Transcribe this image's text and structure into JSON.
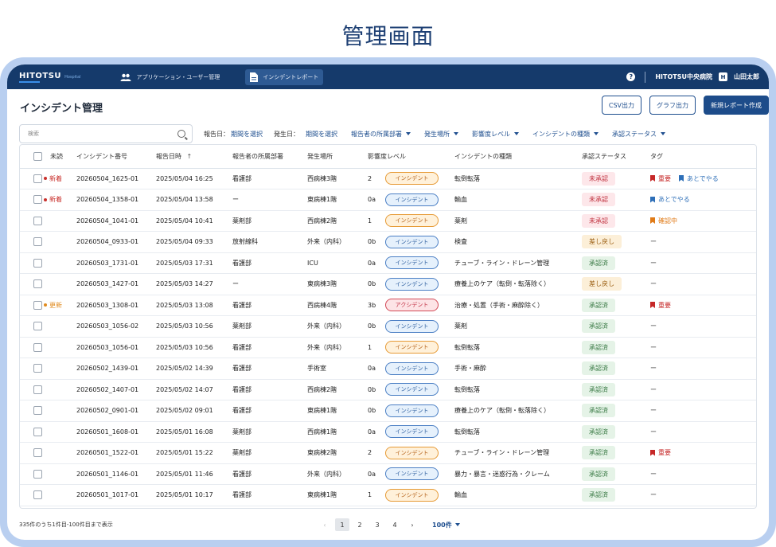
{
  "page_title": "管理画面",
  "header": {
    "logo": "HITOTSU",
    "logo_sub": "Hospital",
    "nav": [
      {
        "label": "アプリケーション・ユーザー管理",
        "icon": "users-icon"
      },
      {
        "label": "インシデントレポート",
        "icon": "document-icon"
      }
    ],
    "help_icon": "?",
    "hospital": "HITOTSU中央病院",
    "user_initial": "H",
    "user_name": "山田太郎"
  },
  "main": {
    "title": "インシデント管理",
    "buttons": {
      "csv": "CSV出力",
      "graph": "グラフ出力",
      "new": "新規レポート作成"
    },
    "search_placeholder": "検索",
    "filters": {
      "report_date_label": "報告日：",
      "report_date_value": "期間を選択",
      "occur_date_label": "発生日：",
      "occur_date_value": "期間を選択",
      "dept": "報告者の所属部署",
      "place": "発生場所",
      "impact": "影響度レベル",
      "type": "インシデントの種類",
      "approval": "承認ステータス"
    },
    "columns": {
      "unread": "未読",
      "number": "インシデント番号",
      "datetime": "報告日時",
      "dept": "報告者の所属部署",
      "place": "発生場所",
      "impact": "影響度レベル",
      "type": "インシデントの種類",
      "approval": "承認ステータス",
      "tag": "タグ"
    },
    "sort_icon": "↑",
    "rows": [
      {
        "unread": "新着",
        "unread_kind": "new",
        "number": "20260504_1625-01",
        "datetime": "2025/05/04 16:25",
        "dept": "看護部",
        "place": "西病棟3階",
        "level": "2",
        "pill": "インシデント",
        "pill_kind": "warn",
        "type": "転倒転落",
        "approval": "未承認",
        "approval_kind": "un",
        "tags": [
          {
            "label": "重要",
            "color": "red"
          },
          {
            "label": "あとでやる",
            "color": "blue"
          }
        ]
      },
      {
        "unread": "新着",
        "unread_kind": "new",
        "number": "20260504_1358-01",
        "datetime": "2025/05/04 13:58",
        "dept": "ー",
        "place": "東病棟1階",
        "level": "0a",
        "pill": "インシデント",
        "pill_kind": "info",
        "type": "輸血",
        "approval": "未承認",
        "approval_kind": "un",
        "tags": [
          {
            "label": "あとでやる",
            "color": "blue"
          }
        ]
      },
      {
        "unread": "",
        "unread_kind": "",
        "number": "20260504_1041-01",
        "datetime": "2025/05/04 10:41",
        "dept": "薬剤部",
        "place": "西病棟2階",
        "level": "1",
        "pill": "インシデント",
        "pill_kind": "warn",
        "type": "薬剤",
        "approval": "未承認",
        "approval_kind": "un",
        "tags": [
          {
            "label": "確認中",
            "color": "orange"
          }
        ]
      },
      {
        "unread": "",
        "unread_kind": "",
        "number": "20260504_0933-01",
        "datetime": "2025/05/04 09:33",
        "dept": "放射線科",
        "place": "外来（内科）",
        "level": "0b",
        "pill": "インシデント",
        "pill_kind": "info",
        "type": "検査",
        "approval": "差し戻し",
        "approval_kind": "back",
        "tags": [],
        "dash": "ー"
      },
      {
        "unread": "",
        "unread_kind": "",
        "number": "20260503_1731-01",
        "datetime": "2025/05/03 17:31",
        "dept": "看護部",
        "place": "ICU",
        "level": "0a",
        "pill": "インシデント",
        "pill_kind": "info",
        "type": "チューブ・ライン・ドレーン管理",
        "approval": "承認済",
        "approval_kind": "ok",
        "tags": [],
        "dash": "ー"
      },
      {
        "unread": "",
        "unread_kind": "",
        "number": "20260503_1427-01",
        "datetime": "2025/05/03 14:27",
        "dept": "ー",
        "place": "東病棟3階",
        "level": "0b",
        "pill": "インシデント",
        "pill_kind": "info",
        "type": "療養上のケア（転倒・転落除く）",
        "approval": "差し戻し",
        "approval_kind": "back",
        "tags": [],
        "dash": "ー"
      },
      {
        "unread": "更新",
        "unread_kind": "upd",
        "number": "20260503_1308-01",
        "datetime": "2025/05/03 13:08",
        "dept": "看護部",
        "place": "西病棟4階",
        "level": "3b",
        "pill": "アクシデント",
        "pill_kind": "acc",
        "type": "治療・処置（手術・麻酔除く）",
        "approval": "承認済",
        "approval_kind": "ok",
        "tags": [
          {
            "label": "重要",
            "color": "red"
          }
        ]
      },
      {
        "unread": "",
        "unread_kind": "",
        "number": "20260503_1056-02",
        "datetime": "2025/05/03 10:56",
        "dept": "薬剤部",
        "place": "外来（内科）",
        "level": "0b",
        "pill": "インシデント",
        "pill_kind": "info",
        "type": "薬剤",
        "approval": "承認済",
        "approval_kind": "ok",
        "tags": [],
        "dash": "ー"
      },
      {
        "unread": "",
        "unread_kind": "",
        "number": "20260503_1056-01",
        "datetime": "2025/05/03 10:56",
        "dept": "看護部",
        "place": "外来（内科）",
        "level": "1",
        "pill": "インシデント",
        "pill_kind": "warn",
        "type": "転倒転落",
        "approval": "承認済",
        "approval_kind": "ok",
        "tags": [],
        "dash": "ー"
      },
      {
        "unread": "",
        "unread_kind": "",
        "number": "20260502_1439-01",
        "datetime": "2025/05/02 14:39",
        "dept": "看護部",
        "place": "手術室",
        "level": "0a",
        "pill": "インシデント",
        "pill_kind": "info",
        "type": "手術・麻酔",
        "approval": "承認済",
        "approval_kind": "ok",
        "tags": [],
        "dash": "ー"
      },
      {
        "unread": "",
        "unread_kind": "",
        "number": "20260502_1407-01",
        "datetime": "2025/05/02 14:07",
        "dept": "看護部",
        "place": "西病棟2階",
        "level": "0b",
        "pill": "インシデント",
        "pill_kind": "info",
        "type": "転倒転落",
        "approval": "承認済",
        "approval_kind": "ok",
        "tags": [],
        "dash": "ー"
      },
      {
        "unread": "",
        "unread_kind": "",
        "number": "20260502_0901-01",
        "datetime": "2025/05/02 09:01",
        "dept": "看護部",
        "place": "東病棟1階",
        "level": "0b",
        "pill": "インシデント",
        "pill_kind": "info",
        "type": "療養上のケア（転倒・転落除く）",
        "approval": "承認済",
        "approval_kind": "ok",
        "tags": [],
        "dash": "ー"
      },
      {
        "unread": "",
        "unread_kind": "",
        "number": "20260501_1608-01",
        "datetime": "2025/05/01 16:08",
        "dept": "薬剤部",
        "place": "西病棟1階",
        "level": "0a",
        "pill": "インシデント",
        "pill_kind": "info",
        "type": "転倒転落",
        "approval": "承認済",
        "approval_kind": "ok",
        "tags": [],
        "dash": "ー"
      },
      {
        "unread": "",
        "unread_kind": "",
        "number": "20260501_1522-01",
        "datetime": "2025/05/01 15:22",
        "dept": "薬剤部",
        "place": "東病棟2階",
        "level": "2",
        "pill": "インシデント",
        "pill_kind": "warn",
        "type": "チューブ・ライン・ドレーン管理",
        "approval": "承認済",
        "approval_kind": "ok",
        "tags": [
          {
            "label": "重要",
            "color": "red"
          }
        ]
      },
      {
        "unread": "",
        "unread_kind": "",
        "number": "20260501_1146-01",
        "datetime": "2025/05/01 11:46",
        "dept": "看護部",
        "place": "外来（内科）",
        "level": "0a",
        "pill": "インシデント",
        "pill_kind": "info",
        "type": "暴力・暴言・迷惑行為・クレーム",
        "approval": "承認済",
        "approval_kind": "ok",
        "tags": [],
        "dash": "ー"
      },
      {
        "unread": "",
        "unread_kind": "",
        "number": "20260501_1017-01",
        "datetime": "2025/05/01 10:17",
        "dept": "看護部",
        "place": "東病棟1階",
        "level": "1",
        "pill": "インシデント",
        "pill_kind": "warn",
        "type": "輸血",
        "approval": "承認済",
        "approval_kind": "ok",
        "tags": [],
        "dash": "ー"
      }
    ],
    "pagination": {
      "summary": "335件のうち1件目-100件目まで表示",
      "prev": "‹",
      "pages": [
        "1",
        "2",
        "3",
        "4"
      ],
      "next": "›",
      "per_page": "100件"
    }
  },
  "colors": {
    "header_bg": "#153a6b",
    "frame": "#b9cff0",
    "accent": "#1d4c8a"
  }
}
